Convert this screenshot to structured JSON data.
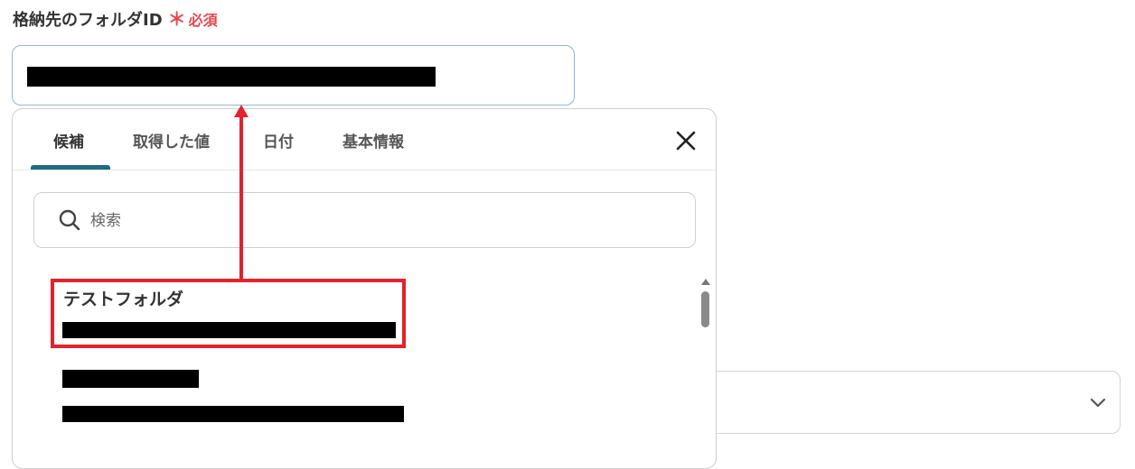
{
  "field": {
    "label": "格納先のフォルダID",
    "required_mark": "＊",
    "required_text": "必須"
  },
  "popup": {
    "tabs": [
      {
        "label": "候補",
        "active": true
      },
      {
        "label": "取得した値",
        "active": false
      },
      {
        "label": "日付",
        "active": false
      },
      {
        "label": "基本情報",
        "active": false
      }
    ],
    "close_icon": "close-icon",
    "search": {
      "placeholder": "検索",
      "value": ""
    },
    "candidates": [
      {
        "name": "テストフォルダ"
      }
    ]
  },
  "colors": {
    "required": "#e5484d",
    "active_tab_underline": "#1e6b82",
    "highlight": "#e3222b",
    "input_focus_border": "#8fb6df"
  }
}
